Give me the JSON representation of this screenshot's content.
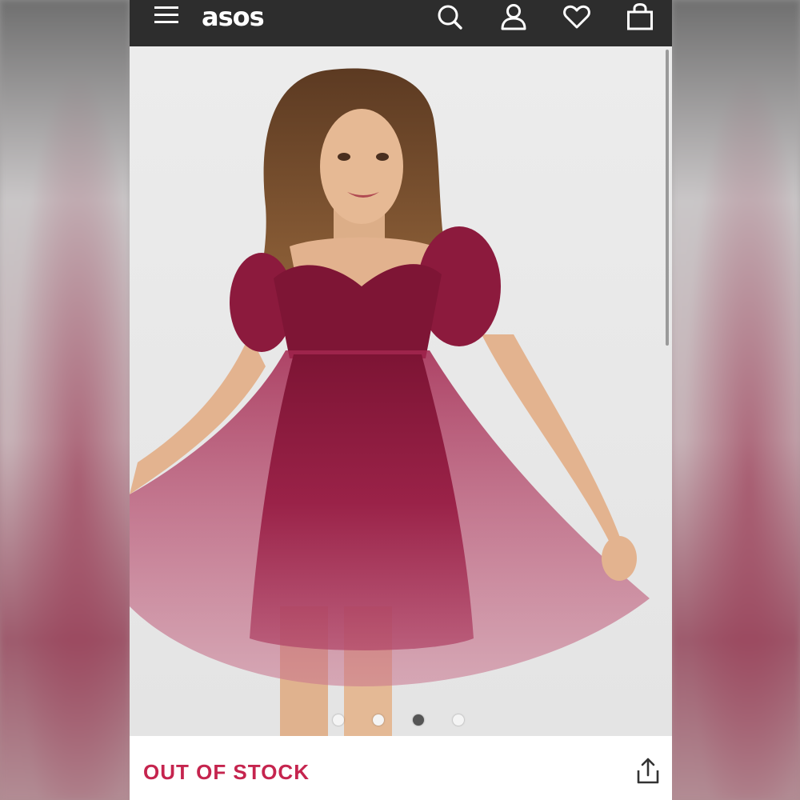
{
  "app": {
    "logo_text": "asos"
  },
  "header": {
    "icons": [
      "menu-icon",
      "search-icon",
      "account-icon",
      "wishlist-icon",
      "bag-icon"
    ]
  },
  "product": {
    "image_description_alt": "",
    "carousel": {
      "total": 4,
      "active_index": 3
    },
    "stock_status": "OUT OF STOCK"
  },
  "colors": {
    "header_bg": "#2d2d2d",
    "accent_red": "#c5244e",
    "dress": "#8e1a3f"
  }
}
